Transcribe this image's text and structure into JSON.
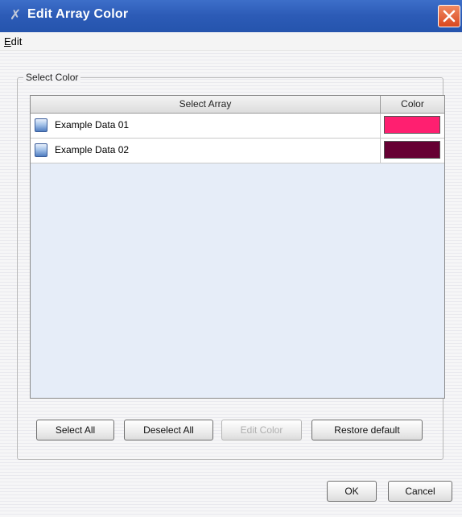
{
  "window": {
    "title": "Edit Array Color",
    "title_icon": "app-icon",
    "close_icon": "close-icon"
  },
  "menu": {
    "edit_label": "Edit",
    "edit_mnemonic": "E",
    "edit_rest": "dit"
  },
  "group": {
    "label": "Select Color"
  },
  "table": {
    "columns": [
      "Select Array",
      "Color"
    ],
    "rows": [
      {
        "label": "Example Data 01",
        "color": "#ff1f70"
      },
      {
        "label": "Example Data 02",
        "color": "#660033"
      }
    ]
  },
  "buttons": {
    "select_all": "Select All",
    "deselect_all": "Deselect All",
    "edit_color": "Edit Color",
    "restore_default": "Restore default",
    "ok": "OK",
    "cancel": "Cancel"
  },
  "colors": {
    "titlebar": "#2c5bb6",
    "close": "#d9471e",
    "table_bg": "#e6edf8"
  }
}
